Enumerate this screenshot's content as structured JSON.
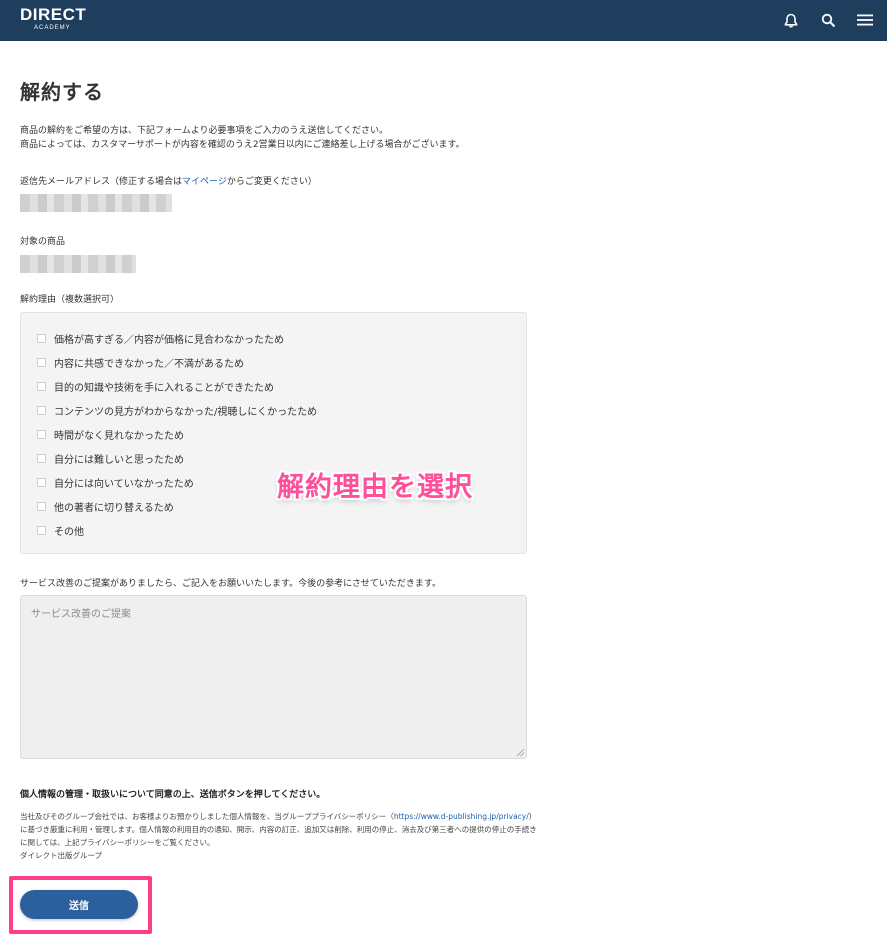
{
  "header": {
    "logo_main": "DIRECT",
    "logo_sub": "ACADEMY",
    "icons": [
      "bell-icon",
      "search-icon",
      "menu-icon"
    ]
  },
  "page": {
    "title": "解約する",
    "intro_line1": "商品の解約をご希望の方は、下記フォームより必要事項をご入力のうえ送信してください。",
    "intro_line2": "商品によっては、カスタマーサポートが内容を確認のうえ2営業日以内にご連絡差し上げる場合がございます。"
  },
  "email": {
    "label_prefix": "返信先メールアドレス（修正する場合は",
    "label_link": "マイページ",
    "label_suffix": "からご変更ください）"
  },
  "product": {
    "label": "対象の商品"
  },
  "reasons": {
    "label": "解約理由（複数選択可）",
    "items": [
      "価格が高すぎる／内容が価格に見合わなかったため",
      "内容に共感できなかった／不満があるため",
      "目的の知識や技術を手に入れることができたため",
      "コンテンツの見方がわからなかった/視聴しにくかったため",
      "時間がなく見れなかったため",
      "自分には難しいと思ったため",
      "自分には向いていなかったため",
      "他の著者に切り替えるため",
      "その他"
    ],
    "overlay_annotation": "解約理由を選択"
  },
  "suggestion": {
    "label": "サービス改善のご提案がありましたら、ご記入をお願いいたします。今後の参考にさせていただきます。",
    "placeholder": "サービス改善のご提案"
  },
  "privacy": {
    "title": "個人情報の管理・取扱いについて同意の上、送信ボタンを押してください。",
    "text_part1": "当社及びそのグループ会社では、お客様よりお預かりしました個人情報を、当グループプライバシーポリシー（",
    "link": "https://www.d-publishing.jp/privacy/",
    "text_part2": "）に基づき厳重に利用・管理します。個人情報の利用目的の通知、開示、内容の訂正、追加又は削除、利用の停止、消去及び第三者への提供の停止の手続きに関しては、上記プライバシーポリシーをご覧ください。",
    "group": "ダイレクト出版グループ"
  },
  "submit_label": "送信",
  "colors": {
    "header_bg": "#1f3d5c",
    "button_bg": "#2b5f9e",
    "highlight": "#ff3d8b",
    "annotation": "#ff4f9a",
    "link": "#1a5fb4"
  }
}
